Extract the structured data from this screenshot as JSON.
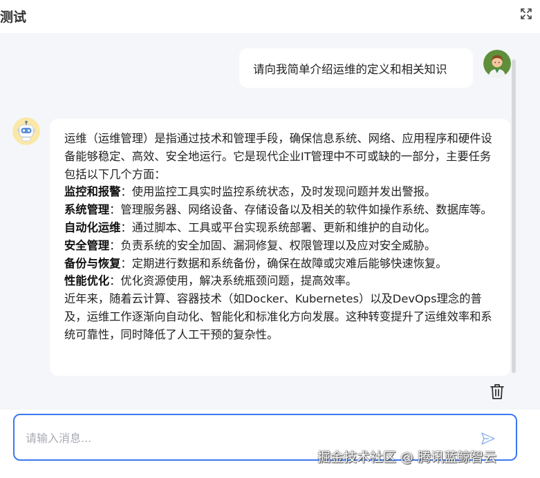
{
  "window": {
    "title": "测试"
  },
  "icons": {
    "fullscreen": "fullscreen-icon",
    "user_avatar": "user-avatar-icon",
    "bot_avatar": "robot-avatar-icon",
    "delete": "trash-icon",
    "send": "send-icon"
  },
  "chat": {
    "user_message": "请向我简单介绍运维的定义和相关知识",
    "bot_reply": {
      "intro": "运维（运维管理）是指通过技术和管理手段，确保信息系统、网络、应用程序和硬件设备能够稳定、高效、安全地运行。它是现代企业IT管理中不可或缺的一部分，主要任务包括以下几个方面：",
      "items": [
        {
          "term": "监控和报警",
          "desc": "：使用监控工具实时监控系统状态，及时发现问题并发出警报。"
        },
        {
          "term": "系统管理",
          "desc": "：管理服务器、网络设备、存储设备以及相关的软件如操作系统、数据库等。"
        },
        {
          "term": "自动化运维",
          "desc": "：通过脚本、工具或平台实现系统部署、更新和维护的自动化。"
        },
        {
          "term": "安全管理",
          "desc": "：负责系统的安全加固、漏洞修复、权限管理以及应对安全威胁。"
        },
        {
          "term": "备份与恢复",
          "desc": "：定期进行数据和系统备份，确保在故障或灾难后能够快速恢复。"
        },
        {
          "term": "性能优化",
          "desc": "：优化资源使用，解决系统瓶颈问题，提高效率。"
        }
      ],
      "conclusion": "近年来，随着云计算、容器技术（如Docker、Kubernetes）以及DevOps理念的普及，运维工作逐渐向自动化、智能化和标准化方向发展。这种转变提升了运维效率和系统可靠性，同时降低了人工干预的复杂性。"
    }
  },
  "input": {
    "placeholder": "请输入消息...",
    "value": ""
  },
  "watermark": "掘金技术社区 @ 腾讯蓝鲸智云",
  "colors": {
    "accent": "#3a78f2",
    "chat_background": "#f4f6f9",
    "bubble": "#ffffff"
  }
}
